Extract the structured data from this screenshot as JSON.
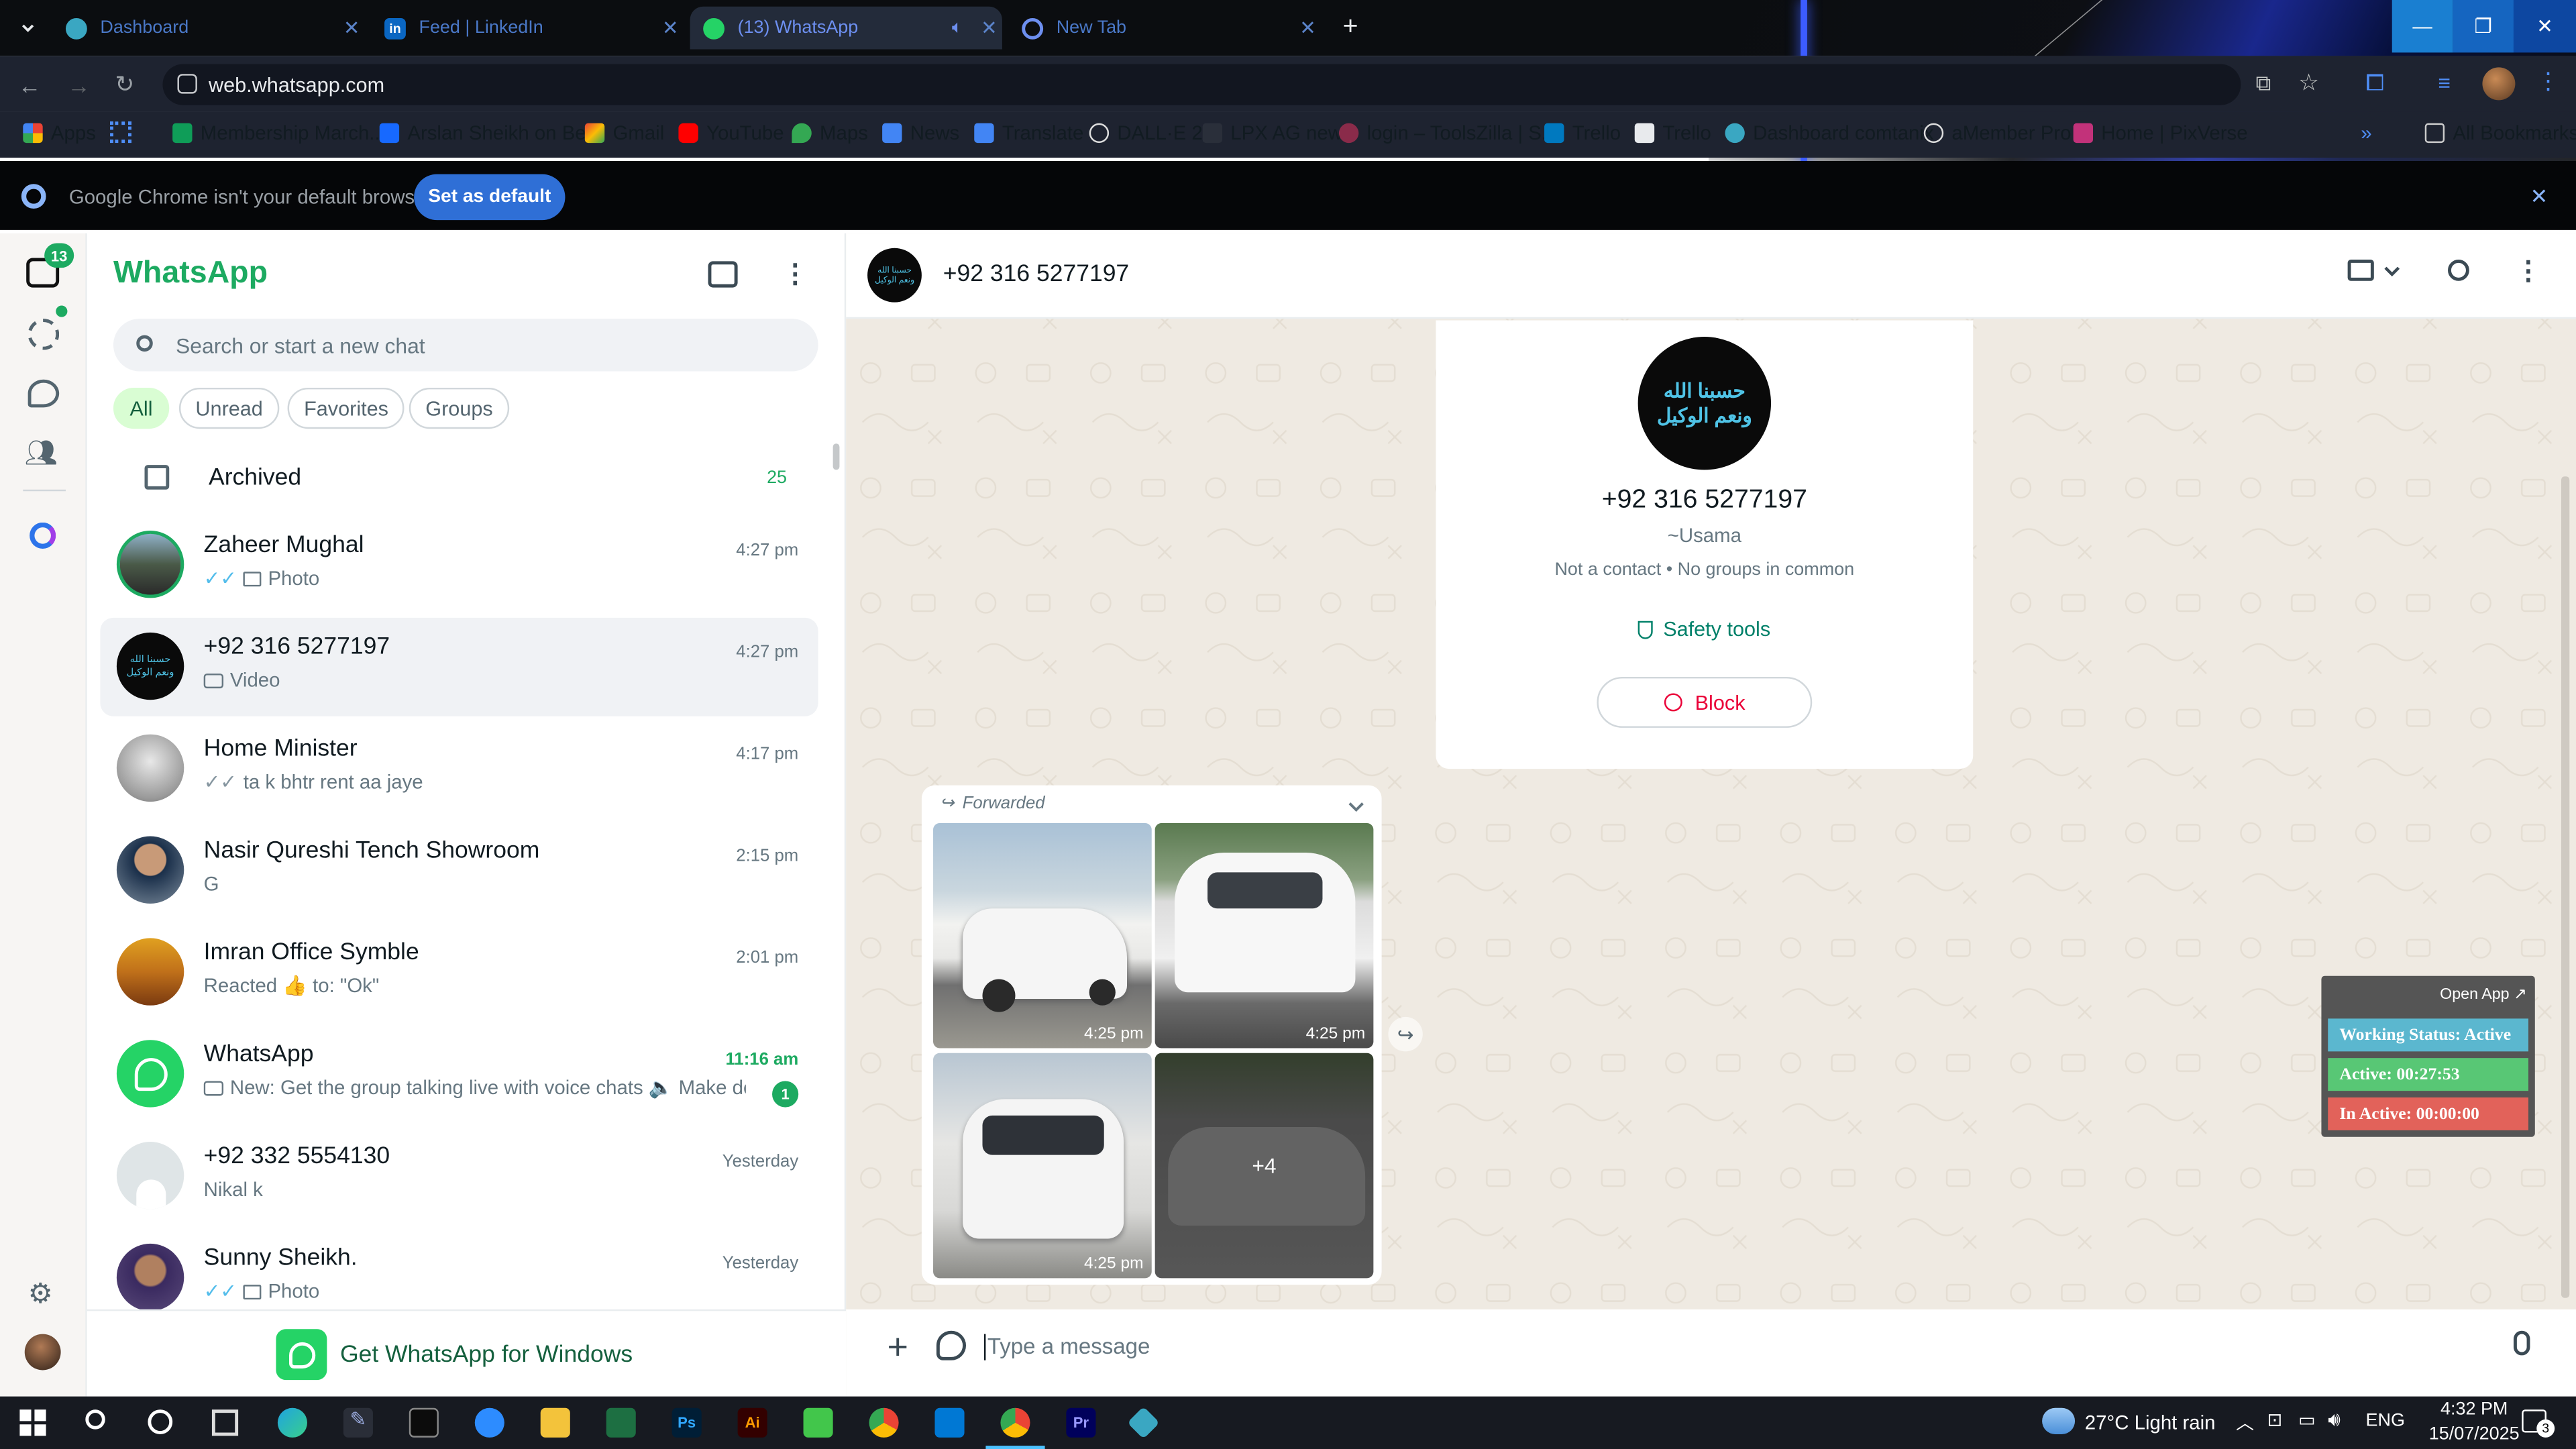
{
  "browser": {
    "tabs": [
      {
        "title": "Dashboard",
        "close": "✕"
      },
      {
        "title": "Feed | LinkedIn",
        "close": "✕"
      },
      {
        "title": "(13) WhatsApp",
        "close": "✕"
      },
      {
        "title": "New Tab",
        "close": "✕"
      }
    ],
    "url": "web.whatsapp.com",
    "bookmarks": [
      "Apps",
      "Membership March...",
      "Arslan Sheikh on Be...",
      "Gmail",
      "YouTube",
      "Maps",
      "News",
      "Translate",
      "DALL·E 2",
      "LPX AG new",
      "login – ToolsZilla | S...",
      "Trello",
      "Trello",
      "Dashboard comtanix",
      "aMember Pro",
      "Home | PixVerse"
    ],
    "all_bookmarks": "All Bookmarks",
    "infobar_text": "Google Chrome isn't your default browser",
    "set_default": "Set as default"
  },
  "rail": {
    "badge": "13"
  },
  "sidebar": {
    "title": "WhatsApp",
    "search_placeholder": "Search or start a new chat",
    "filters": [
      "All",
      "Unread",
      "Favorites",
      "Groups"
    ],
    "archived": {
      "label": "Archived",
      "count": "25"
    },
    "chats": [
      {
        "name": "Zaheer Mughal",
        "time": "4:27 pm",
        "preview": "Photo"
      },
      {
        "name": "+92 316 5277197",
        "time": "4:27 pm",
        "preview": "Video"
      },
      {
        "name": "Home Minister",
        "time": "4:17 pm",
        "preview": "ta k bhtr rent aa jaye"
      },
      {
        "name": "Nasir Qureshi Tench Showroom",
        "time": "2:15 pm",
        "preview": "G"
      },
      {
        "name": "Imran Office Symble",
        "time": "2:01 pm",
        "preview": "Reacted 👍 to: \"Ok\""
      },
      {
        "name": "WhatsApp",
        "time": "11:16 am",
        "preview": "New: Get the group talking live with voice chats 🔈 Make dec...",
        "unread": "1"
      },
      {
        "name": "+92 332 5554130",
        "time": "Yesterday",
        "preview": "Nikal k"
      },
      {
        "name": "Sunny Sheikh.",
        "time": "Yesterday",
        "preview": "Photo"
      }
    ],
    "get_app": "Get WhatsApp for Windows"
  },
  "conversation": {
    "header_name": "+92 316 5277197",
    "profile": {
      "avatar_text_line1": "حسبنا الله",
      "avatar_text_line2": "ونعم الوكيل",
      "number": "+92 316 5277197",
      "push_name": "~Usama",
      "meta": "Not a contact • No groups in common",
      "safety": "Safety tools",
      "block": "Block"
    },
    "message": {
      "forwarded": "Forwarded",
      "times": [
        "4:25 pm",
        "4:25 pm",
        "4:25 pm"
      ],
      "more": "+4"
    },
    "composer_placeholder": "Type a message"
  },
  "tracker": {
    "open_app": "Open App ↗",
    "status": "Working Status: Active",
    "active": "Active: 00:27:53",
    "inactive": "In Active: 00:00:00",
    "colors": {
      "status": "#5bb7cf",
      "active": "#58c775",
      "inactive": "#e2625a"
    }
  },
  "taskbar": {
    "weather": "27°C  Light rain",
    "lang": "ENG",
    "time": "4:32 PM",
    "date": "15/07/2025",
    "notif": "3"
  },
  "colors": {
    "brand": "#1daa61",
    "accent_chip": "#d9fdd3",
    "chrome_blue": "#2f6fd6"
  }
}
